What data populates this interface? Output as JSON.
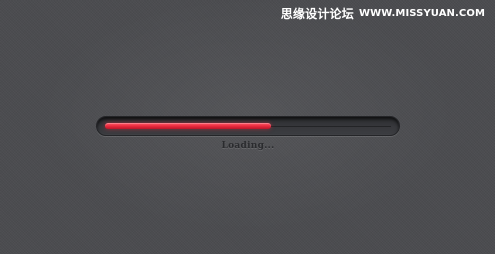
{
  "watermark": {
    "site_cn": "思缘设计论坛",
    "site_url": "WWW.MISSYUAN.COM"
  },
  "loader": {
    "status_text": "Loading...",
    "progress_fraction": 0.58,
    "fill_color": "#e8283b",
    "track_color": "#333438",
    "background_color": "#4a4b4f"
  }
}
